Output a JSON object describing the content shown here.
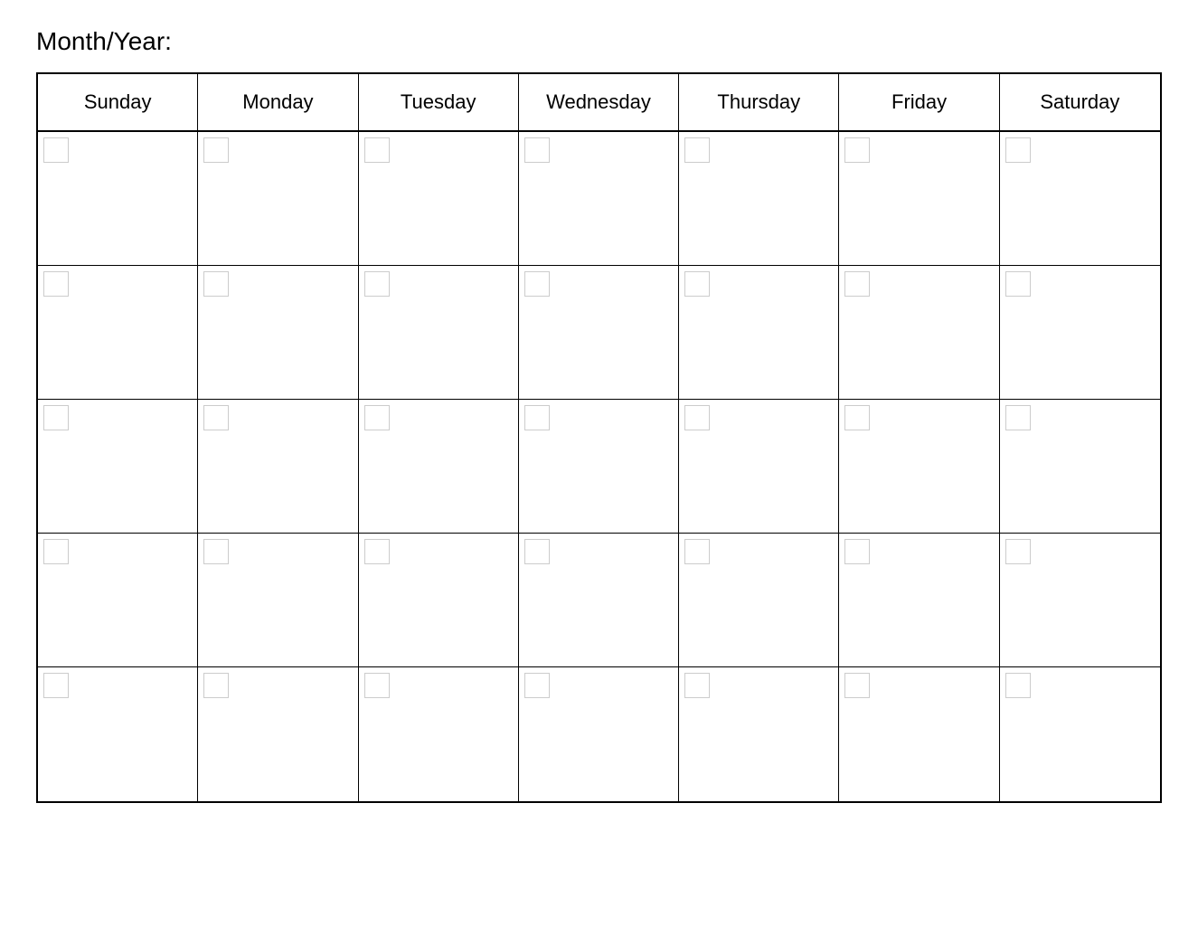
{
  "header": {
    "month_year_label": "Month/Year:"
  },
  "calendar": {
    "days": [
      {
        "label": "Sunday"
      },
      {
        "label": "Monday"
      },
      {
        "label": "Tuesday"
      },
      {
        "label": "Wednesday"
      },
      {
        "label": "Thursday"
      },
      {
        "label": "Friday"
      },
      {
        "label": "Saturday"
      }
    ],
    "weeks": [
      {
        "id": "week-1"
      },
      {
        "id": "week-2"
      },
      {
        "id": "week-3"
      },
      {
        "id": "week-4"
      },
      {
        "id": "week-5"
      }
    ]
  }
}
